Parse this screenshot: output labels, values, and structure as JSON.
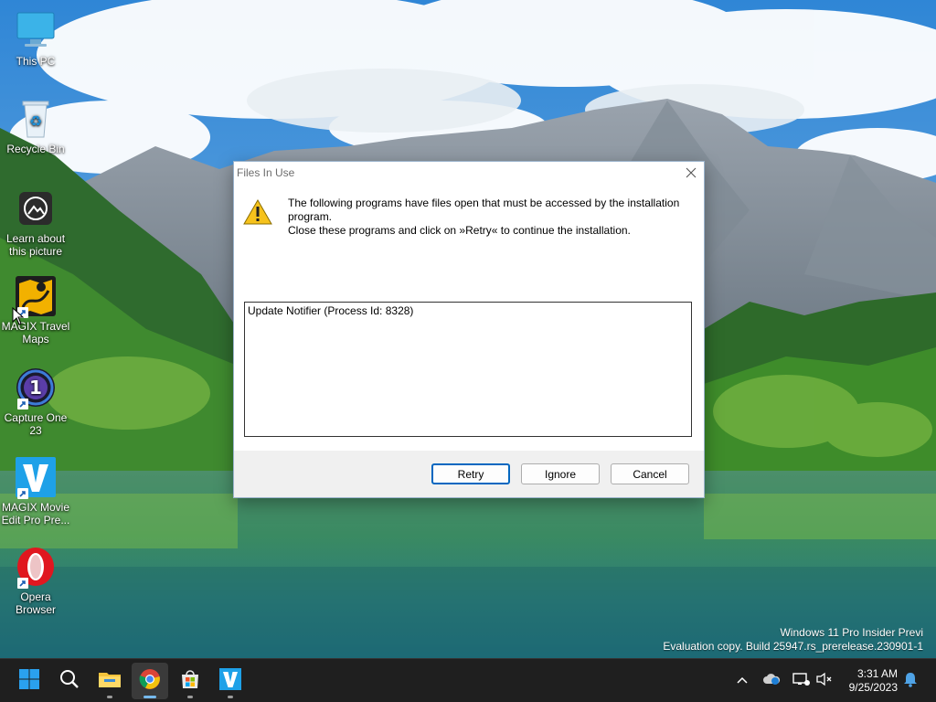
{
  "desktop": {
    "icons": [
      {
        "label": "This PC",
        "icon": "this-pc-icon"
      },
      {
        "label": "Recycle Bin",
        "icon": "recycle-bin-icon"
      },
      {
        "label": "Learn about this picture",
        "icon": "learn-about-picture-icon"
      },
      {
        "label": "MAGIX Travel Maps",
        "icon": "magix-travel-maps-icon"
      },
      {
        "label": "Capture One 23",
        "icon": "capture-one-icon"
      },
      {
        "label": "MAGIX Movie Edit Pro Pre...",
        "icon": "magix-movie-edit-icon"
      },
      {
        "label": "Opera Browser",
        "icon": "opera-icon"
      }
    ]
  },
  "dialog": {
    "title": "Files In Use",
    "message_line1": "The following programs have files open that must be accessed by the installation",
    "message_line2": "program.",
    "message_line3": "Close these programs and click on »Retry« to continue the installation.",
    "processes": [
      "Update Notifier (Process Id: 8328)"
    ],
    "buttons": {
      "retry": "Retry",
      "ignore": "Ignore",
      "cancel": "Cancel"
    }
  },
  "watermark": {
    "line1": "Windows 11 Pro Insider Previ",
    "line2": "Evaluation copy. Build 25947.rs_prerelease.230901-1"
  },
  "taskbar": {
    "apps": [
      "start",
      "search",
      "file-explorer",
      "chrome",
      "microsoft-store",
      "magix-movie-edit"
    ],
    "active_app": "chrome",
    "clock": {
      "time": "3:31 AM",
      "date": "9/25/2023"
    }
  },
  "colors": {
    "accent": "#0067c0",
    "taskbar": "#1f1f1f",
    "dialog_bg": "#f0f0f0"
  }
}
